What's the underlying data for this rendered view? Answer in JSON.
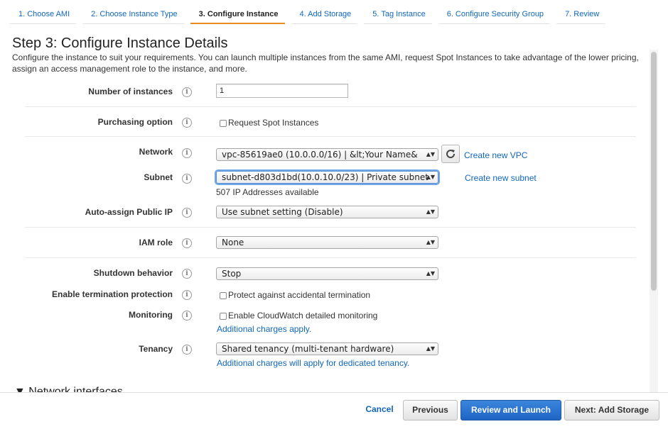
{
  "tabs": [
    {
      "label": "1. Choose AMI"
    },
    {
      "label": "2. Choose Instance Type"
    },
    {
      "label": "3. Configure Instance"
    },
    {
      "label": "4. Add Storage"
    },
    {
      "label": "5. Tag Instance"
    },
    {
      "label": "6. Configure Security Group"
    },
    {
      "label": "7. Review"
    }
  ],
  "active_tab": "3. Configure Instance",
  "page": {
    "title": "Step 3: Configure Instance Details",
    "description": "Configure the instance to suit your requirements. You can launch multiple instances from the same AMI, request Spot Instances to take advantage of the lower pricing, assign an access management role to the instance, and more."
  },
  "form": {
    "num_instances": {
      "label": "Number of instances",
      "value": "1"
    },
    "purchasing": {
      "label": "Purchasing option",
      "checkbox_label": "Request Spot Instances"
    },
    "network": {
      "label": "Network",
      "value": "vpc-85619ae0 (10.0.0.0/16) | &lt;Your Name&",
      "link": "Create new VPC"
    },
    "subnet": {
      "label": "Subnet",
      "value": "subnet-d803d1bd(10.0.10.0/23) | Private subnet",
      "link": "Create new subnet",
      "note": "507 IP Addresses available"
    },
    "public_ip": {
      "label": "Auto-assign Public IP",
      "value": "Use subnet setting (Disable)"
    },
    "iam_role": {
      "label": "IAM role",
      "value": "None"
    },
    "shutdown": {
      "label": "Shutdown behavior",
      "value": "Stop"
    },
    "termination": {
      "label": "Enable termination protection",
      "checkbox_label": "Protect against accidental termination"
    },
    "monitoring": {
      "label": "Monitoring",
      "checkbox_label": "Enable CloudWatch detailed monitoring",
      "link": "Additional charges apply."
    },
    "tenancy": {
      "label": "Tenancy",
      "value": "Shared tenancy (multi-tenant hardware)",
      "link": "Additional charges will apply for dedicated tenancy."
    }
  },
  "section": {
    "label": "Network interfaces",
    "icon": "triangle-down-icon"
  },
  "info_glyph": "i",
  "footer": {
    "cancel": "Cancel",
    "previous": "Previous",
    "review": "Review and Launch",
    "next": "Next: Add Storage"
  },
  "colors": {
    "accent": "#e78b1f",
    "link": "#1166bb",
    "primary_button": "#1f64c4"
  }
}
